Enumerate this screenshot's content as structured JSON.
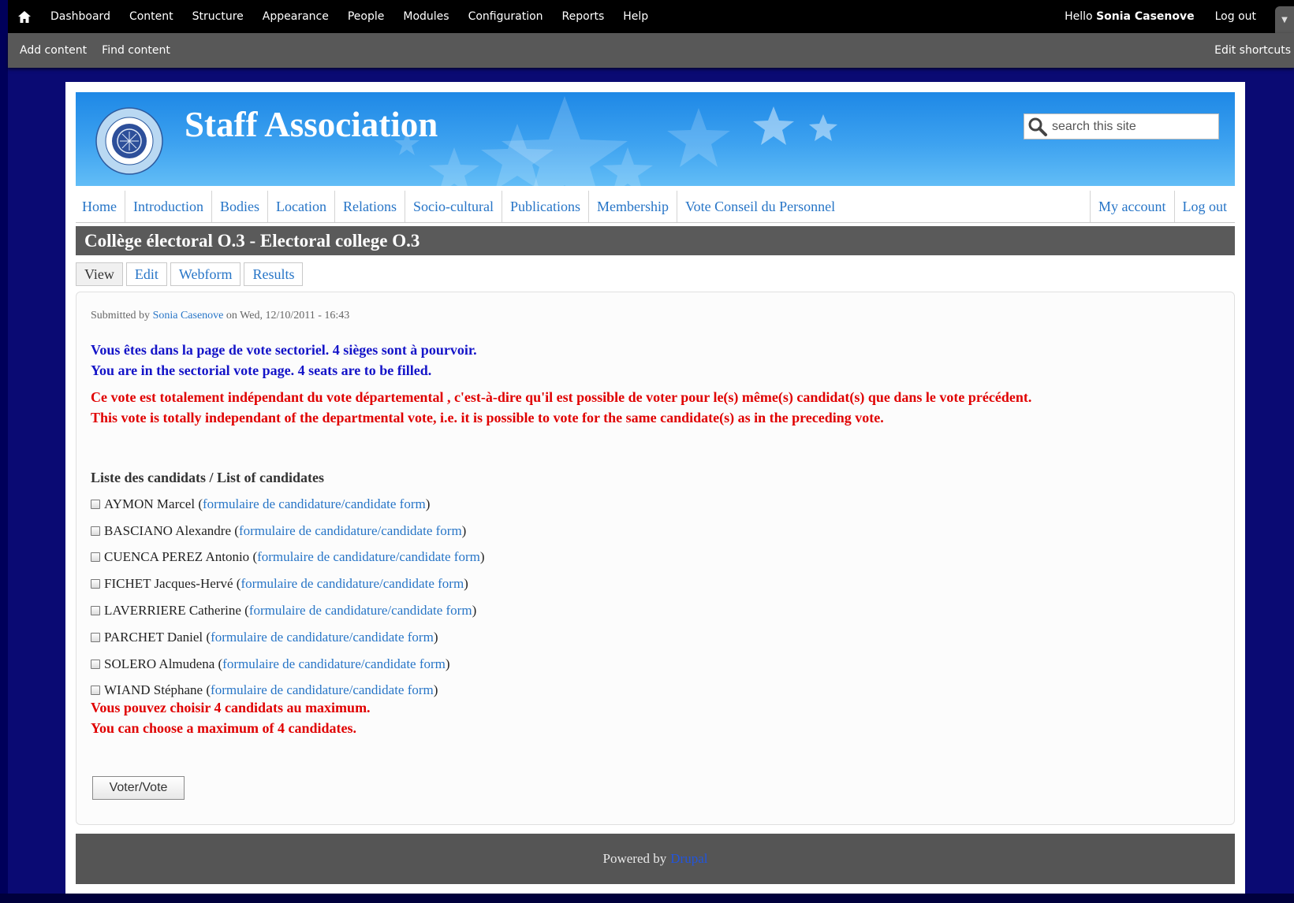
{
  "toolbar": {
    "menu": [
      "Dashboard",
      "Content",
      "Structure",
      "Appearance",
      "People",
      "Modules",
      "Configuration",
      "Reports",
      "Help"
    ],
    "hello_prefix": "Hello",
    "user_name": "Sonia Casenove",
    "logout": "Log out",
    "shortcuts": [
      "Add content",
      "Find content"
    ],
    "edit_shortcuts": "Edit shortcuts"
  },
  "header": {
    "site_name": "Staff Association",
    "search_placeholder": "search this site"
  },
  "main_menu": {
    "left": [
      "Home",
      "Introduction",
      "Bodies",
      "Location",
      "Relations",
      "Socio-cultural",
      "Publications",
      "Membership",
      "Vote Conseil du Personnel"
    ],
    "right": [
      "My account",
      "Log out"
    ]
  },
  "page": {
    "title": "Collège électoral O.3 - Electoral college O.3",
    "tabs": [
      "View",
      "Edit",
      "Webform",
      "Results"
    ]
  },
  "content": {
    "submitted_prefix": "Submitted by",
    "author": "Sonia Casenove",
    "submitted_suffix": "on Wed, 12/10/2011 - 16:43",
    "intro_fr": "Vous êtes dans la page de vote sectoriel. 4 sièges sont à pourvoir.",
    "intro_en": "You are in the sectorial vote page.  4 seats are to be filled.",
    "note_fr": "Ce vote est totalement indépendant du vote départemental , c'est-à-dire qu'il est possible de voter pour le(s) même(s) candidat(s) que dans le vote précédent.",
    "note_en": "This vote is totally independant of the departmental vote, i.e. it is possible to vote for the same candidate(s) as in the preceding vote.",
    "list_heading": "Liste des candidats / List of candidates",
    "form_link": "formulaire de candidature/candidate form",
    "candidates": [
      "AYMON Marcel",
      "BASCIANO Alexandre",
      "CUENCA PEREZ Antonio",
      "FICHET Jacques-Hervé",
      "LAVERRIERE Catherine",
      "PARCHET Daniel",
      "SOLERO Almudena",
      "WIAND Stéphane"
    ],
    "max_fr": "Vous pouvez choisir 4 candidats au maximum.",
    "max_en": "You can choose a maximum of 4 candidates.",
    "vote_button": "Voter/Vote"
  },
  "footer": {
    "powered_by": "Powered by",
    "drupal": "Drupal"
  },
  "icons": {
    "home": "home-icon",
    "search": "magnifier-icon",
    "checkbox": "checkbox"
  },
  "colors": {
    "page_bg": "#0a0a73",
    "link": "#2775c7",
    "intro_text": "#1414c8",
    "warning_text": "#e00000",
    "title_bar": "#5a5a5a"
  }
}
